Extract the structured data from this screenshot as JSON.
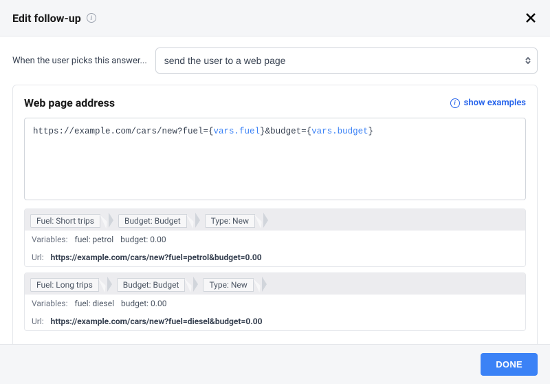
{
  "header": {
    "title": "Edit follow-up"
  },
  "action": {
    "label": "When the user picks this answer...",
    "selected": "send the user to a web page"
  },
  "panel": {
    "title": "Web page address",
    "examples_link": "show examples",
    "url_template": {
      "parts": [
        {
          "t": "text",
          "v": "https://example.com/cars/new?fuel={"
        },
        {
          "t": "var",
          "v": "vars.fuel"
        },
        {
          "t": "text",
          "v": "}&budget={"
        },
        {
          "t": "var",
          "v": "vars.budget"
        },
        {
          "t": "text",
          "v": "}"
        }
      ]
    },
    "previews": [
      {
        "crumbs": [
          "Fuel: Short trips",
          "Budget: Budget",
          "Type: New"
        ],
        "vars_label": "Variables:",
        "vars": [
          {
            "k": "fuel",
            "v": "petrol"
          },
          {
            "k": "budget",
            "v": "0.00"
          }
        ],
        "url_label": "Url:",
        "url": "https://example.com/cars/new?fuel=petrol&budget=0.00"
      },
      {
        "crumbs": [
          "Fuel: Long trips",
          "Budget: Budget",
          "Type: New"
        ],
        "vars_label": "Variables:",
        "vars": [
          {
            "k": "fuel",
            "v": "diesel"
          },
          {
            "k": "budget",
            "v": "0.00"
          }
        ],
        "url_label": "Url:",
        "url": "https://example.com/cars/new?fuel=diesel&budget=0.00"
      }
    ]
  },
  "footer": {
    "done": "DONE"
  }
}
